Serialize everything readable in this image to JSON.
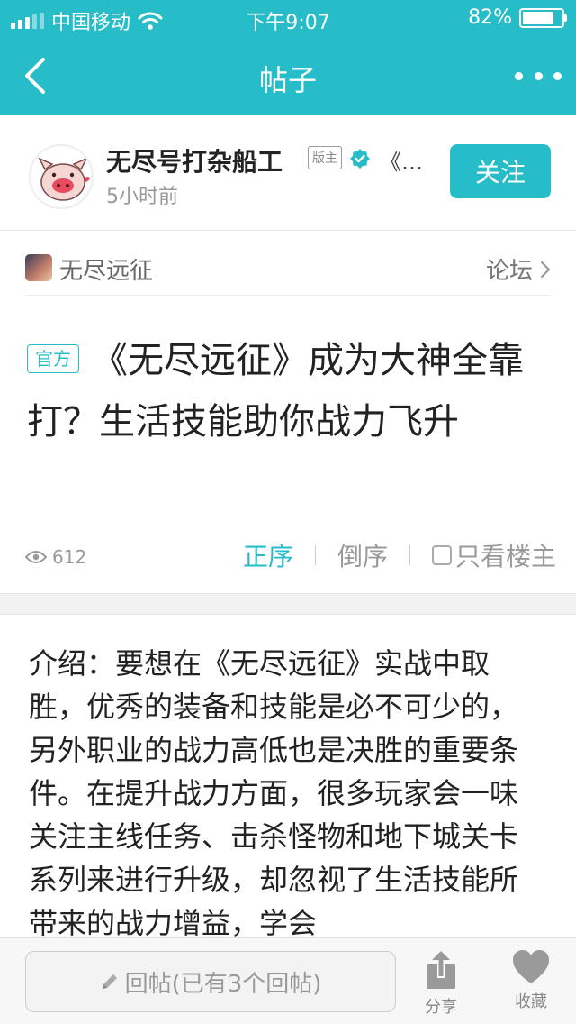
{
  "status_bar": {
    "carrier": "中国移动",
    "time": "下午9:07",
    "battery": "82%",
    "battery_level": 0.82
  },
  "navbar": {
    "title": "帖子",
    "back_icon": "chevron-left-icon",
    "more_icon": "more-dots-icon"
  },
  "author": {
    "name": "无尽号打杂船工",
    "role_badge": "版主",
    "extra": "《…",
    "time": "5小时前",
    "follow_label": "关注"
  },
  "forum": {
    "name": "无尽远征",
    "link_label": "论坛"
  },
  "post": {
    "tag": "官方",
    "title": "《无尽远征》成为大神全靠打？生活技能助你战力飞升",
    "views": "612",
    "sort_asc": "正序",
    "sort_desc": "倒序",
    "only_op": "只看楼主",
    "body": "介绍：要想在《无尽远征》实战中取胜，优秀的装备和技能是必不可少的，另外职业的战力高低也是决胜的重要条件。在提升战力方面，很多玩家会一味关注主线任务、击杀怪物和地下城关卡系列来进行升级，却忽视了生活技能所带来的战力增益，学会"
  },
  "bottom_bar": {
    "reply_placeholder": "回帖(已有3个回帖)",
    "share_label": "分享",
    "favorite_label": "收藏"
  },
  "colors": {
    "accent": "#26bcc8"
  }
}
